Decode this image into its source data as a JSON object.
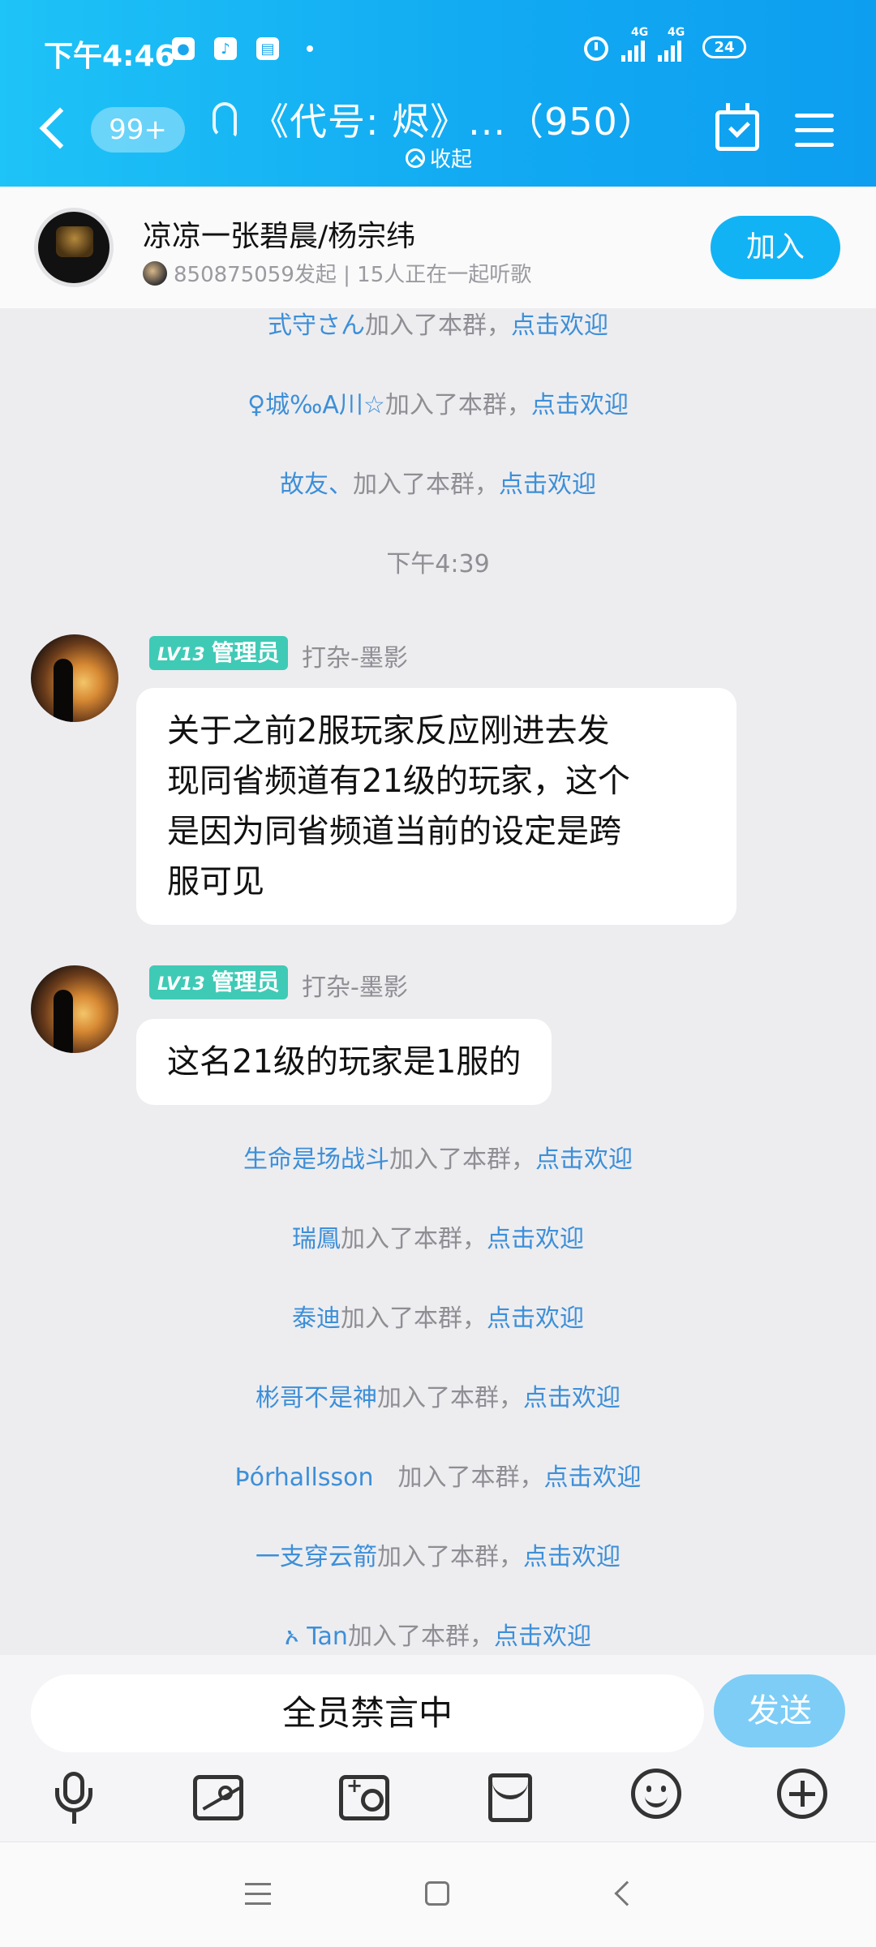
{
  "status_bar": {
    "time": "下午4:46",
    "network_1": "4G",
    "network_2": "4G",
    "battery": "24"
  },
  "nav": {
    "unread_badge": "99+",
    "title": "《代号: 烬》...（950）",
    "collapse_label": "收起"
  },
  "listen": {
    "song": "凉凉一张碧晨/杨宗纬",
    "subtitle": "850875059发起 | 15人正在一起听歌",
    "join_label": "加入"
  },
  "system_messages_top": [
    {
      "name": "式守さん",
      "text": "加入了本群，",
      "link": "点击欢迎"
    },
    {
      "name": "♀城‰A川☆",
      "text": "加入了本群，",
      "link": "点击欢迎"
    },
    {
      "name": "故友、",
      "text": "加入了本群，",
      "link": "点击欢迎"
    }
  ],
  "timestamp": "下午4:39",
  "messages": [
    {
      "level": "LV13",
      "role": "管理员",
      "sender": "打杂-墨影",
      "lines": [
        "关于之前2服玩家反应刚进去发",
        "现同省频道有21级的玩家，这个",
        "是因为同省频道当前的设定是跨",
        "服可见"
      ]
    },
    {
      "level": "LV13",
      "role": "管理员",
      "sender": "打杂-墨影",
      "lines": [
        "这名21级的玩家是1服的"
      ]
    }
  ],
  "system_messages_bottom": [
    {
      "name": "生命是场战斗",
      "text": "加入了本群，",
      "link": "点击欢迎"
    },
    {
      "name": "瑞鳳",
      "text": "加入了本群，",
      "link": "点击欢迎"
    },
    {
      "name": "泰迪",
      "text": "加入了本群，",
      "link": "点击欢迎"
    },
    {
      "name": "彬哥不是神",
      "text": "加入了本群，",
      "link": "点击欢迎"
    },
    {
      "name": "Þórhallsson　",
      "text": "加入了本群，",
      "link": "点击欢迎"
    },
    {
      "name": "一支穿云箭",
      "text": "加入了本群，",
      "link": "点击欢迎"
    },
    {
      "name": "ኦ Tan",
      "text": "加入了本群，",
      "link": "点击欢迎"
    }
  ],
  "input": {
    "placeholder": "全员禁言中",
    "send_label": "发送"
  },
  "colors": {
    "header": "#12aaf2",
    "accent": "#12b3f4",
    "link": "#3d8fd8",
    "badge": "#3fcab6"
  }
}
